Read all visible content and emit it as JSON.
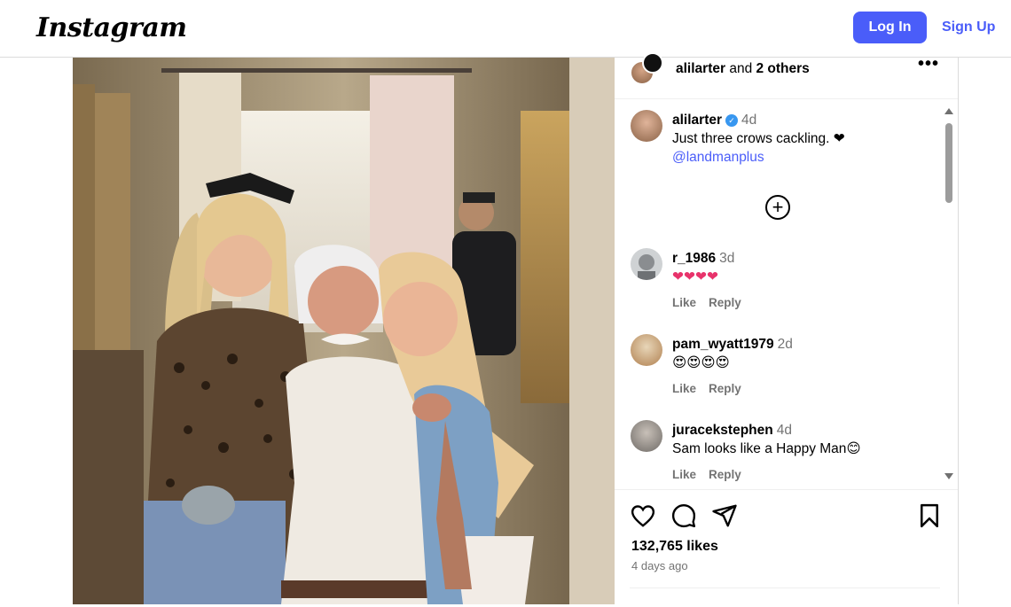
{
  "app": {
    "logo": "Instagram",
    "login_label": "Log In",
    "signup_label": "Sign Up"
  },
  "post": {
    "header": {
      "owner": "alilarter",
      "joiner": " and ",
      "others": "2 others"
    },
    "caption": {
      "user": "alilarter",
      "verified": true,
      "time": "4d",
      "text": "Just three crows cackling. ❤",
      "mention": "@landmanplus"
    },
    "comments": [
      {
        "user": "r_1986",
        "time": "3d",
        "text": "❤❤❤❤",
        "like_label": "Like",
        "reply_label": "Reply"
      },
      {
        "user": "pam_wyatt1979",
        "time": "2d",
        "text": "😍😍😍😍",
        "like_label": "Like",
        "reply_label": "Reply"
      },
      {
        "user": "juracekstephen",
        "time": "4d",
        "text": "Sam looks like a Happy Man😊",
        "like_label": "Like",
        "reply_label": "Reply"
      }
    ],
    "likes": "132,765 likes",
    "posted_ago": "4 days ago"
  },
  "icons": {
    "like": "heart-icon",
    "comment": "comment-icon",
    "share": "share-icon",
    "save": "bookmark-icon",
    "more": "more-options-icon",
    "load_more": "plus-circle-icon"
  },
  "colors": {
    "primary_button": "#4a5df9",
    "link": "#4a5df9",
    "muted": "#737373",
    "heart": "#e8336b"
  }
}
